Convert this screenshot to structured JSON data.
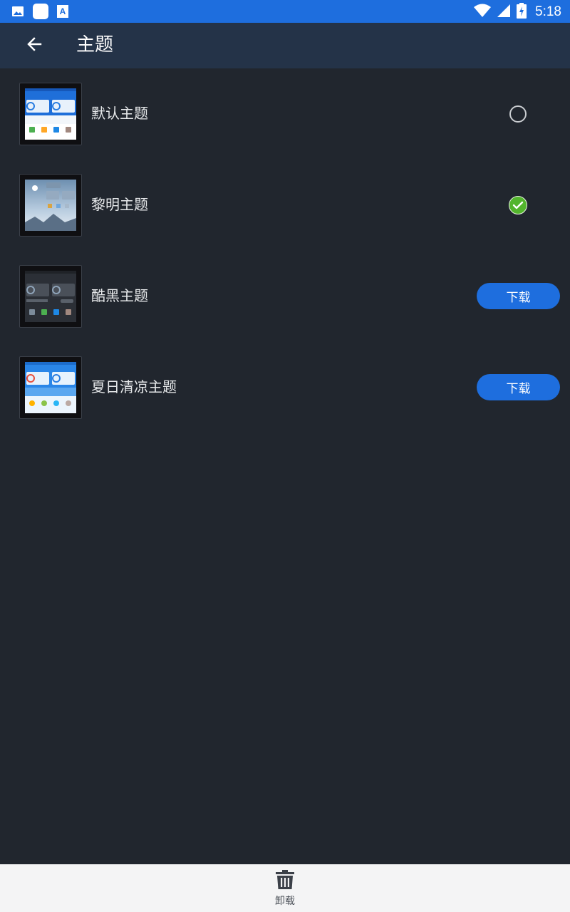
{
  "status_bar": {
    "time": "5:18",
    "left_icons": [
      "image-icon",
      "app-icon",
      "text-a-icon"
    ],
    "right_icons": [
      "wifi-icon",
      "signal-icon",
      "battery-charging-icon"
    ]
  },
  "app_bar": {
    "back_icon": "arrow-left-icon",
    "title": "主题"
  },
  "themes": [
    {
      "name": "默认主题",
      "state": "unselected"
    },
    {
      "name": "黎明主题",
      "state": "selected"
    },
    {
      "name": "酷黑主题",
      "state": "download",
      "action_label": "下载"
    },
    {
      "name": "夏日清凉主题",
      "state": "download",
      "action_label": "下载"
    }
  ],
  "bottom_bar": {
    "icon": "trash-icon",
    "label": "卸载"
  },
  "colors": {
    "status_bar": "#1e6ede",
    "app_bar": "#243348",
    "background": "#21262e",
    "accent": "#1e6ede",
    "selected_check": "#53b52d"
  }
}
